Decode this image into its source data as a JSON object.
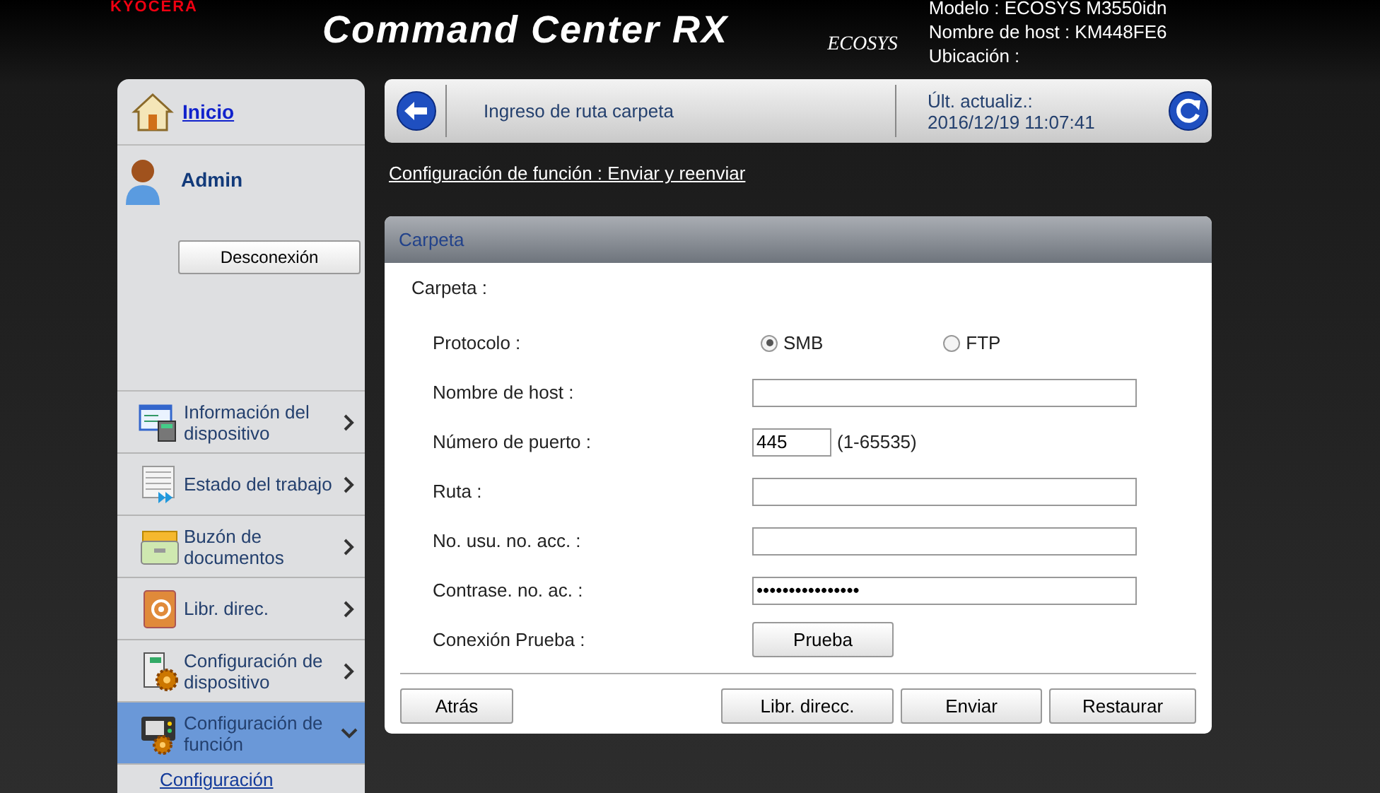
{
  "header": {
    "brand": "KYOCERA",
    "title": "Command Center RX",
    "product_logo": "ECOSYS",
    "device_info": [
      "Modelo : ECOSYS M3550idn",
      "Nombre de host : KM448FE6",
      "Ubicación :"
    ]
  },
  "sidebar": {
    "home_link": "Inicio",
    "user": "Admin",
    "logout_button": "Desconexión",
    "items": [
      {
        "kind": "info",
        "label": "Información del dispositivo",
        "selected": false,
        "expanded": false
      },
      {
        "kind": "jobs",
        "label": "Estado del trabajo",
        "selected": false,
        "expanded": false
      },
      {
        "kind": "box",
        "label": "Buzón de documentos",
        "selected": false,
        "expanded": false
      },
      {
        "kind": "book",
        "label": "Libr. direc.",
        "selected": false,
        "expanded": false
      },
      {
        "kind": "device",
        "label": "Configuración de dispositivo",
        "selected": false,
        "expanded": false
      },
      {
        "kind": "function",
        "label": "Configuración de función",
        "selected": true,
        "expanded": true
      }
    ],
    "subitems": [
      "Configuración"
    ]
  },
  "toolbar": {
    "page_title": "Ingreso de ruta carpeta",
    "updated_label": "Últ. actualiz.:",
    "updated_time": "2016/12/19 11:07:41"
  },
  "breadcrumb": "Configuración de función : Enviar y reenviar",
  "panel": {
    "title": "Carpeta",
    "section_label": "Carpeta :",
    "fields": [
      {
        "kind": "radio",
        "label": "Protocolo :",
        "options": [
          {
            "label": "SMB",
            "selected": true
          },
          {
            "label": "FTP",
            "selected": false
          }
        ]
      },
      {
        "kind": "text",
        "label": "Nombre de host :"
      },
      {
        "kind": "number",
        "label": "Número de puerto :",
        "value": "445",
        "hint": "(1-65535)"
      },
      {
        "kind": "text",
        "label": "Ruta :"
      },
      {
        "kind": "text",
        "label": "No. usu. no. acc. :"
      },
      {
        "kind": "text",
        "label": "Contrase. no. ac. :",
        "value": "••••••••••••••••"
      },
      {
        "kind": "button",
        "label": "Conexión Prueba :",
        "button": "Prueba"
      }
    ],
    "left_buttons": [
      "Atrás"
    ],
    "right_buttons": [
      "Libr. direcc.",
      "Enviar",
      "Restaurar"
    ]
  }
}
